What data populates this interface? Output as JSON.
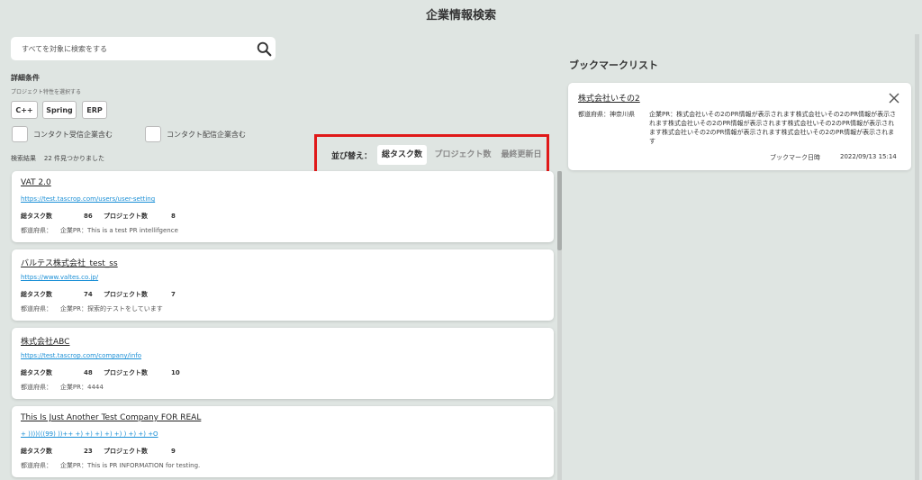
{
  "header": {
    "title": "企業情報検索"
  },
  "search": {
    "placeholder": "すべてを対象に検索をする"
  },
  "filters": {
    "title": "詳細条件",
    "subtitle": "プロジェクト特性を選択する",
    "chips": [
      "C++",
      "Spring",
      "ERP"
    ],
    "checkboxes": [
      "コンタクト受信企業含む",
      "コンタクト配信企業含む"
    ]
  },
  "results": {
    "label": "検索結果",
    "count_text": "22 件見つかりました"
  },
  "sort": {
    "label": "並び替え：",
    "options": [
      "総タスク数",
      "プロジェクト数",
      "最終更新日"
    ],
    "active": "総タスク数"
  },
  "companies": [
    {
      "name": "VAT 2.0",
      "url": "https://test.tascrop.com/users/user-setting",
      "tasks_label": "総タスク数",
      "tasks": "86",
      "projects_label": "プロジェクト数",
      "projects": "8",
      "pref_label": "都道府県：",
      "pr": "企業PR：This is a test PR intellifgence"
    },
    {
      "name": "バルテス株式会社_test_ss",
      "url": "https://www.valtes.co.jp/",
      "tasks_label": "総タスク数",
      "tasks": "74",
      "projects_label": "プロジェクト数",
      "projects": "7",
      "pref_label": "都道府県：",
      "pr": "企業PR：探索的テストをしています"
    },
    {
      "name": "株式会社ABC",
      "url": "https://test.tascrop.com/company/info",
      "tasks_label": "総タスク数",
      "tasks": "48",
      "projects_label": "プロジェクト数",
      "projects": "10",
      "pref_label": "都道府県：",
      "pr": "企業PR：4444"
    },
    {
      "name": "This Is Just Another Test Company FOR REAL",
      "url": "+ ))))(((99) ))++ +) +) +) +) +) ) +) +) +O",
      "tasks_label": "総タスク数",
      "tasks": "23",
      "projects_label": "プロジェクト数",
      "projects": "9",
      "pref_label": "都道府県：",
      "pr": "企業PR：This is PR INFORMATION for testing."
    }
  ],
  "bookmarks": {
    "title": "ブックマークリスト",
    "items": [
      {
        "name": "株式会社いその2",
        "pref": "都道府県：神奈川県",
        "pr": "企業PR：株式会社いその2のPR情報が表示されます株式会社いその2のPR情報が表示されます株式会社いその2のPR情報が表示されます株式会社いその2のPR情報が表示されます株式会社いその2のPR情報が表示されます株式会社いその2のPR情報が表示されます",
        "date_label": "ブックマーク日時",
        "date": "2022/09/13 15:14"
      }
    ]
  },
  "icons": {
    "search": "search-icon",
    "close": "close-icon"
  },
  "colors": {
    "background": "#dfe5e2",
    "link": "#1a8fd6",
    "highlight": "#e01818"
  }
}
